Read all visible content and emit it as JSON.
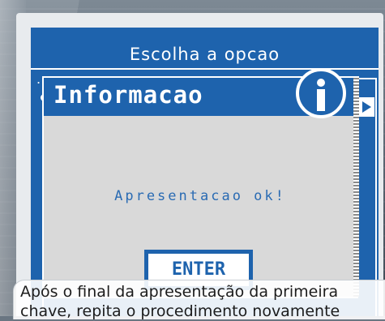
{
  "menu": {
    "title": "Escolha a opcao",
    "marker": "."
  },
  "dialog": {
    "title": "Informacao",
    "icon": "info-icon",
    "message": "Apresentacao ok!",
    "button_label": "ENTER"
  },
  "caption": {
    "line1": "Após o final da apresentação da primeira",
    "line2": "chave, repita o procedimento novamente"
  },
  "colors": {
    "screen_blue": "#1e63ad",
    "dialog_gray": "#d9d9d9",
    "text_white": "#ffffff"
  }
}
